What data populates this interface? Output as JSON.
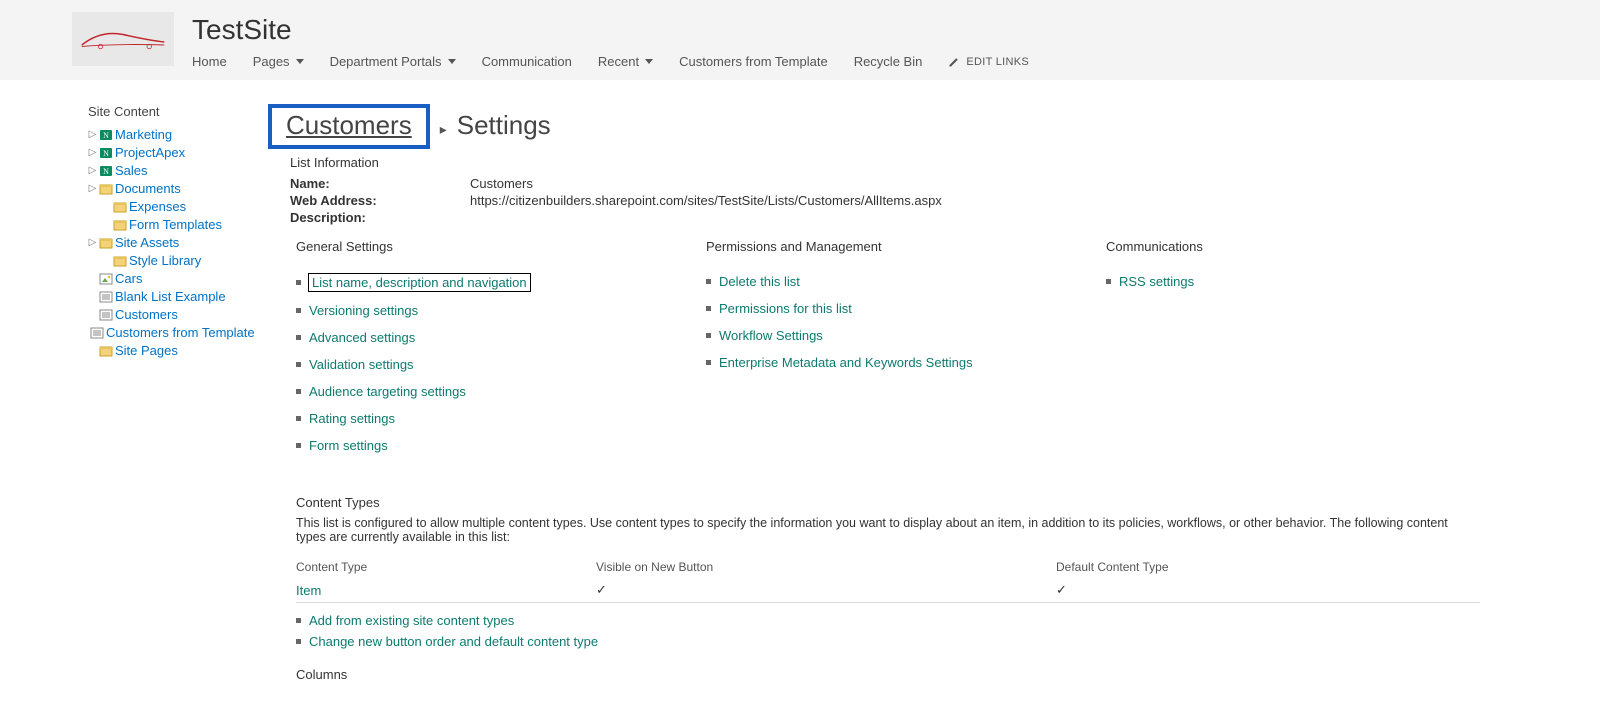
{
  "site": {
    "title": "TestSite"
  },
  "topnav": {
    "items": [
      {
        "label": "Home",
        "caret": false
      },
      {
        "label": "Pages",
        "caret": true
      },
      {
        "label": "Department Portals",
        "caret": true
      },
      {
        "label": "Communication",
        "caret": false
      },
      {
        "label": "Recent",
        "caret": true
      },
      {
        "label": "Customers from Template",
        "caret": false
      },
      {
        "label": "Recycle Bin",
        "caret": false
      }
    ],
    "edit_links": "EDIT LINKS"
  },
  "sidenav": {
    "title": "Site Content",
    "items": [
      {
        "label": "Marketing",
        "caret": true,
        "icon": "onenote",
        "child": false
      },
      {
        "label": "ProjectApex",
        "caret": true,
        "icon": "onenote",
        "child": false
      },
      {
        "label": "Sales",
        "caret": true,
        "icon": "onenote",
        "child": false
      },
      {
        "label": "Documents",
        "caret": true,
        "icon": "library",
        "child": false
      },
      {
        "label": "Expenses",
        "caret": false,
        "icon": "library",
        "child": true
      },
      {
        "label": "Form Templates",
        "caret": false,
        "icon": "library",
        "child": true
      },
      {
        "label": "Site Assets",
        "caret": true,
        "icon": "library",
        "child": false
      },
      {
        "label": "Style Library",
        "caret": false,
        "icon": "library",
        "child": true
      },
      {
        "label": "Cars",
        "caret": false,
        "icon": "piclib",
        "child": false
      },
      {
        "label": "Blank List Example",
        "caret": false,
        "icon": "list",
        "child": false
      },
      {
        "label": "Customers",
        "caret": false,
        "icon": "list",
        "child": false
      },
      {
        "label": "Customers from Template",
        "caret": false,
        "icon": "list",
        "child": false
      },
      {
        "label": "Site Pages",
        "caret": false,
        "icon": "library",
        "child": false
      }
    ]
  },
  "breadcrumb": {
    "parent": "Customers",
    "current": "Settings"
  },
  "list_info": {
    "heading": "List Information",
    "name_label": "Name:",
    "name_value": "Customers",
    "web_label": "Web Address:",
    "web_value": "https://citizenbuilders.sharepoint.com/sites/TestSite/Lists/Customers/AllItems.aspx",
    "desc_label": "Description:"
  },
  "settings_cols": {
    "general": {
      "head": "General Settings",
      "items": [
        "List name, description and navigation",
        "Versioning settings",
        "Advanced settings",
        "Validation settings",
        "Audience targeting settings",
        "Rating settings",
        "Form settings"
      ]
    },
    "perms": {
      "head": "Permissions and Management",
      "items": [
        "Delete this list",
        "Permissions for this list",
        "Workflow Settings",
        "Enterprise Metadata and Keywords Settings"
      ]
    },
    "comms": {
      "head": "Communications",
      "items": [
        "RSS settings"
      ]
    }
  },
  "content_types": {
    "head": "Content Types",
    "desc": "This list is configured to allow multiple content types. Use content types to specify the information you want to display about an item, in addition to its policies, workflows, or other behavior. The following content types are currently available in this list:",
    "cols": [
      "Content Type",
      "Visible on New Button",
      "Default Content Type"
    ],
    "row": {
      "name": "Item",
      "visible": "✓",
      "default": "✓"
    },
    "links": [
      "Add from existing site content types",
      "Change new button order and default content type"
    ]
  },
  "columns": {
    "head": "Columns"
  }
}
